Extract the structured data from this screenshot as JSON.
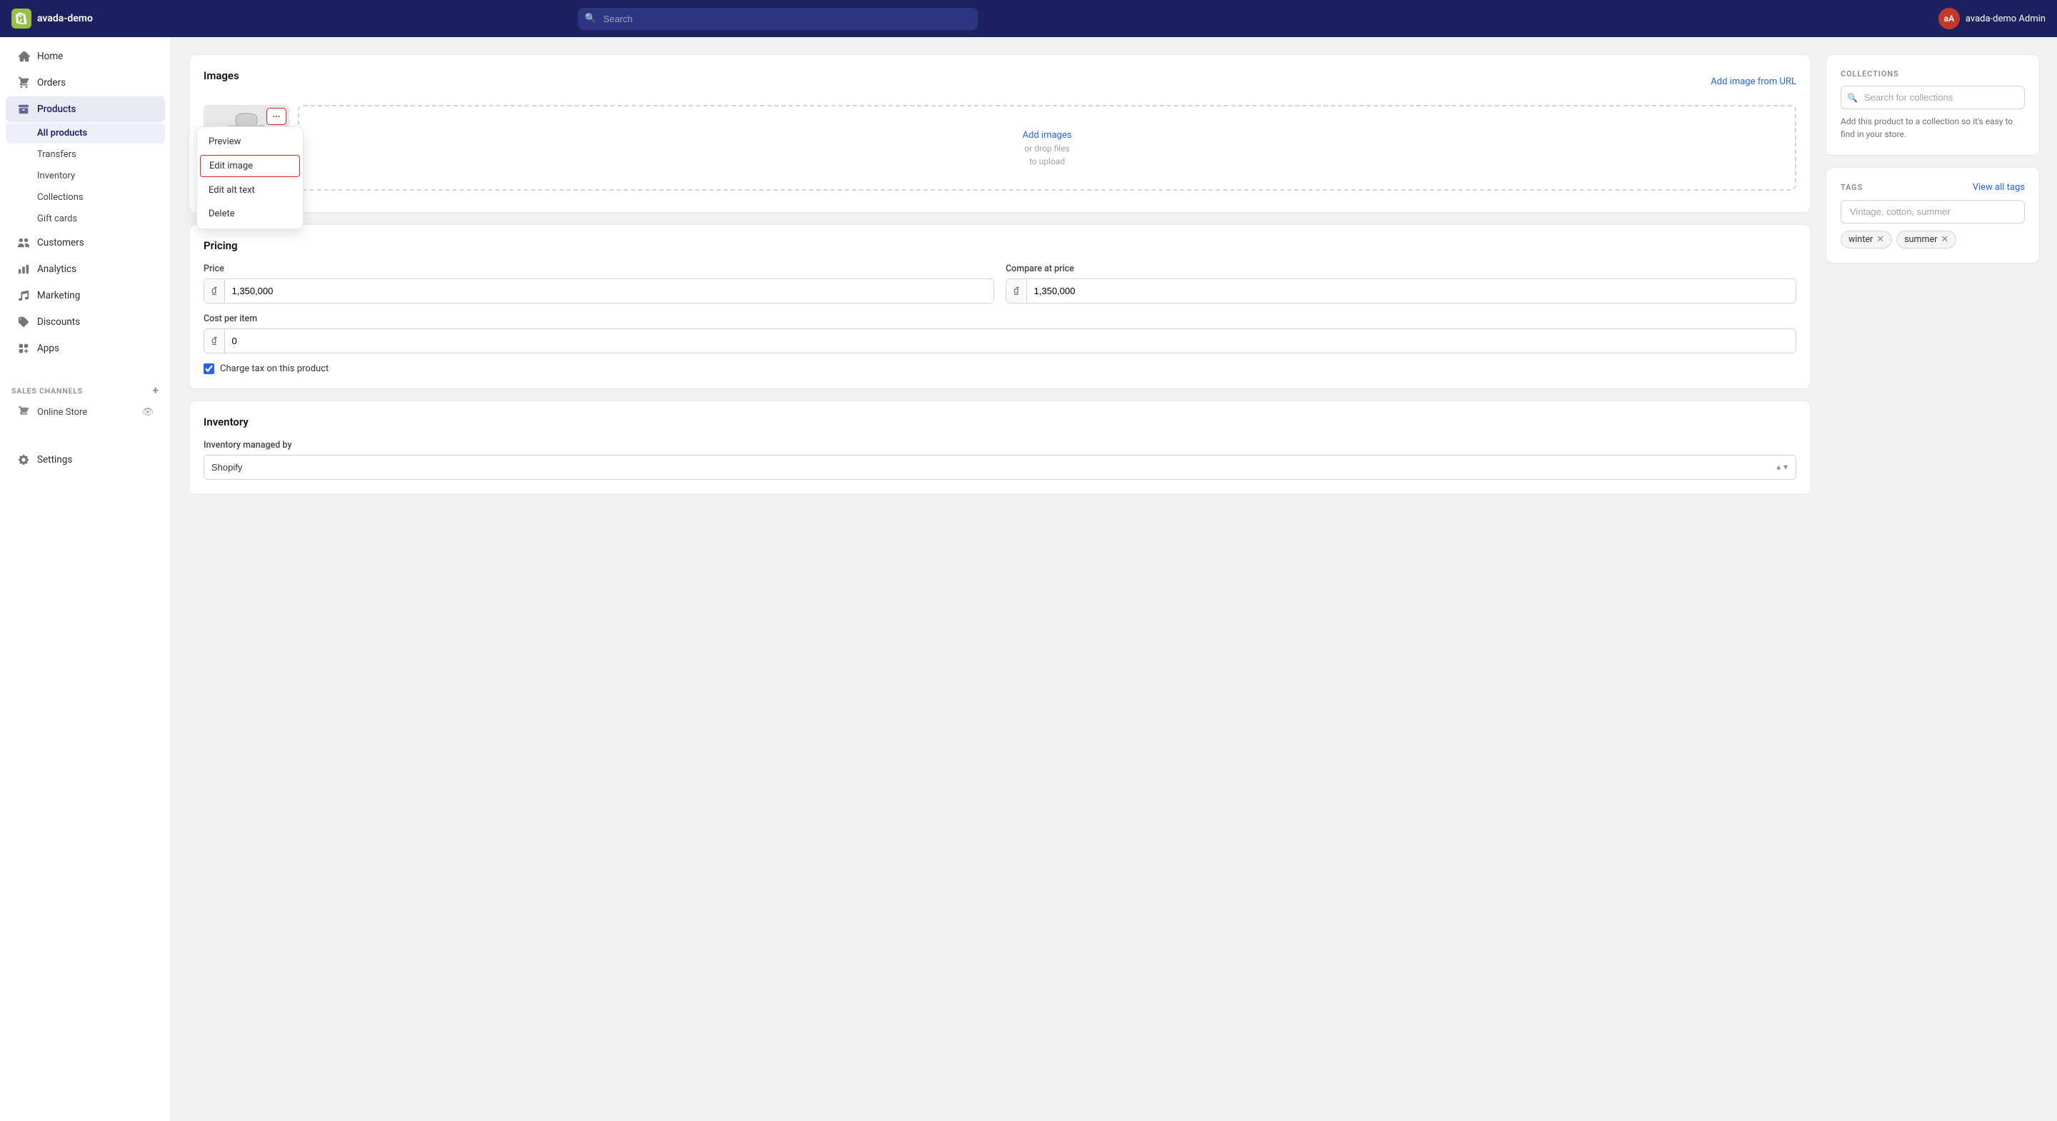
{
  "topnav": {
    "store_name": "avada-demo",
    "search_placeholder": "Search",
    "user_label": "avada-demo Admin",
    "user_initials": "aA"
  },
  "sidebar": {
    "items": [
      {
        "id": "home",
        "label": "Home",
        "icon": "home"
      },
      {
        "id": "orders",
        "label": "Orders",
        "icon": "orders"
      },
      {
        "id": "products",
        "label": "Products",
        "icon": "products",
        "active": true
      },
      {
        "id": "customers",
        "label": "Customers",
        "icon": "customers"
      },
      {
        "id": "analytics",
        "label": "Analytics",
        "icon": "analytics"
      },
      {
        "id": "marketing",
        "label": "Marketing",
        "icon": "marketing"
      },
      {
        "id": "discounts",
        "label": "Discounts",
        "icon": "discounts"
      },
      {
        "id": "apps",
        "label": "Apps",
        "icon": "apps"
      }
    ],
    "products_sub": [
      {
        "id": "all-products",
        "label": "All products",
        "active": true
      },
      {
        "id": "transfers",
        "label": "Transfers"
      },
      {
        "id": "inventory",
        "label": "Inventory"
      },
      {
        "id": "collections",
        "label": "Collections"
      },
      {
        "id": "gift-cards",
        "label": "Gift cards"
      }
    ],
    "sales_channels_label": "SALES CHANNELS",
    "online_store_label": "Online Store",
    "settings_label": "Settings"
  },
  "images_card": {
    "title": "Images",
    "add_image_url_label": "Add image from URL",
    "add_images_label": "Add images",
    "upload_hint1": "or drop files",
    "upload_hint2": "to upload",
    "more_menu": {
      "preview_label": "Preview",
      "edit_image_label": "Edit image",
      "edit_alt_text_label": "Edit alt text",
      "delete_label": "Delete"
    }
  },
  "pricing_card": {
    "title": "Pricing",
    "price_label": "Price",
    "price_value": "1,350,000",
    "compare_label": "Compare at price",
    "compare_value": "1,350,000",
    "cost_label": "Cost per item",
    "cost_value": "0",
    "currency_symbol": "₫",
    "charge_tax_label": "Charge tax on this product"
  },
  "inventory_card": {
    "title": "Inventory",
    "managed_by_label": "Inventory managed by",
    "managed_by_value": "Shopify"
  },
  "right_panel": {
    "collections_title": "COLLECTIONS",
    "collections_search_placeholder": "Search for collections",
    "collections_hint": "Add this product to a collection so it's easy to find in your store.",
    "tags_title": "TAGS",
    "view_all_tags_label": "View all tags",
    "tags_input_placeholder": "Vintage, cotton, summer",
    "tags": [
      {
        "id": "winter",
        "label": "winter"
      },
      {
        "id": "summer",
        "label": "summer"
      }
    ]
  }
}
